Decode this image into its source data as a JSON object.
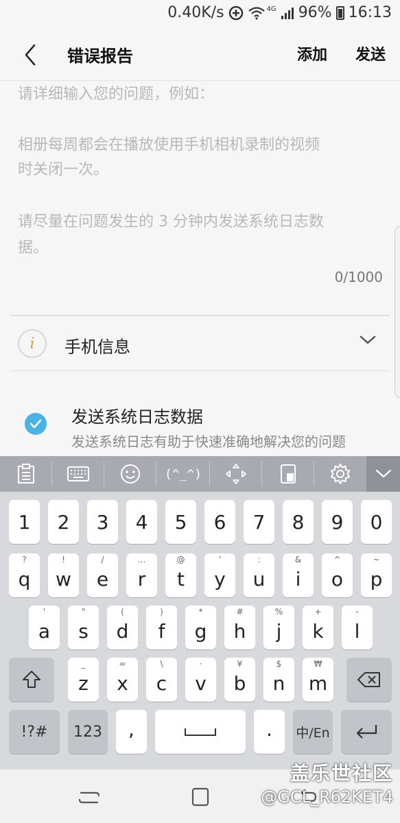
{
  "status_bar": {
    "speed": "0.40K/s",
    "network": "4G",
    "battery": "96%",
    "time": "16:13"
  },
  "app_bar": {
    "title": "错误报告",
    "add_label": "添加",
    "send_label": "发送"
  },
  "description": {
    "placeholder_lines": [
      "请详细输入您的问题，例如：",
      "相册每周都会在播放使用手机相机录制的视频",
      "时关闭一次。",
      "请尽量在问题发生的 3 分钟内发送系统日志数",
      "据。"
    ],
    "counter": "0/1000"
  },
  "phone_info": {
    "icon_glyph": "i",
    "label": "手机信息"
  },
  "send_logs": {
    "checked": true,
    "title": "发送系统日志数据",
    "subtitle": "发送系统日志有助于快速准确地解决您的问题"
  },
  "keyboard": {
    "toolbar": {
      "emoticon_label": "(^_^)"
    },
    "number_row": [
      "1",
      "2",
      "3",
      "4",
      "5",
      "6",
      "7",
      "8",
      "9",
      "0"
    ],
    "row1": [
      {
        "key": "q",
        "hint": "?"
      },
      {
        "key": "w",
        "hint": "!"
      },
      {
        "key": "e",
        "hint": "/"
      },
      {
        "key": "r",
        "hint": "..."
      },
      {
        "key": "t",
        "hint": "@"
      },
      {
        "key": "y",
        "hint": "'"
      },
      {
        "key": "u",
        "hint": ":"
      },
      {
        "key": "i",
        "hint": "&"
      },
      {
        "key": "o",
        "hint": "^"
      },
      {
        "key": "p",
        "hint": "~"
      }
    ],
    "row2": [
      {
        "key": "a",
        "hint": "'"
      },
      {
        "key": "s",
        "hint": "\""
      },
      {
        "key": "d",
        "hint": "("
      },
      {
        "key": "f",
        "hint": ")"
      },
      {
        "key": "g",
        "hint": "*"
      },
      {
        "key": "h",
        "hint": "#"
      },
      {
        "key": "j",
        "hint": "%"
      },
      {
        "key": "k",
        "hint": "+"
      },
      {
        "key": "l",
        "hint": "-"
      }
    ],
    "row3": [
      {
        "key": "z",
        "hint": "_"
      },
      {
        "key": "x",
        "hint": "="
      },
      {
        "key": "c",
        "hint": "\\"
      },
      {
        "key": "v",
        "hint": "·"
      },
      {
        "key": "b",
        "hint": "¥"
      },
      {
        "key": "n",
        "hint": "$"
      },
      {
        "key": "m",
        "hint": "₩"
      }
    ],
    "symbols_label": "!?#",
    "numbers_label": "123",
    "comma_label": ",",
    "period_label": ".",
    "lang_label": "中/En"
  },
  "watermark": {
    "line1": "盖乐世社区",
    "line2": "@GCL_R62KET4"
  }
}
